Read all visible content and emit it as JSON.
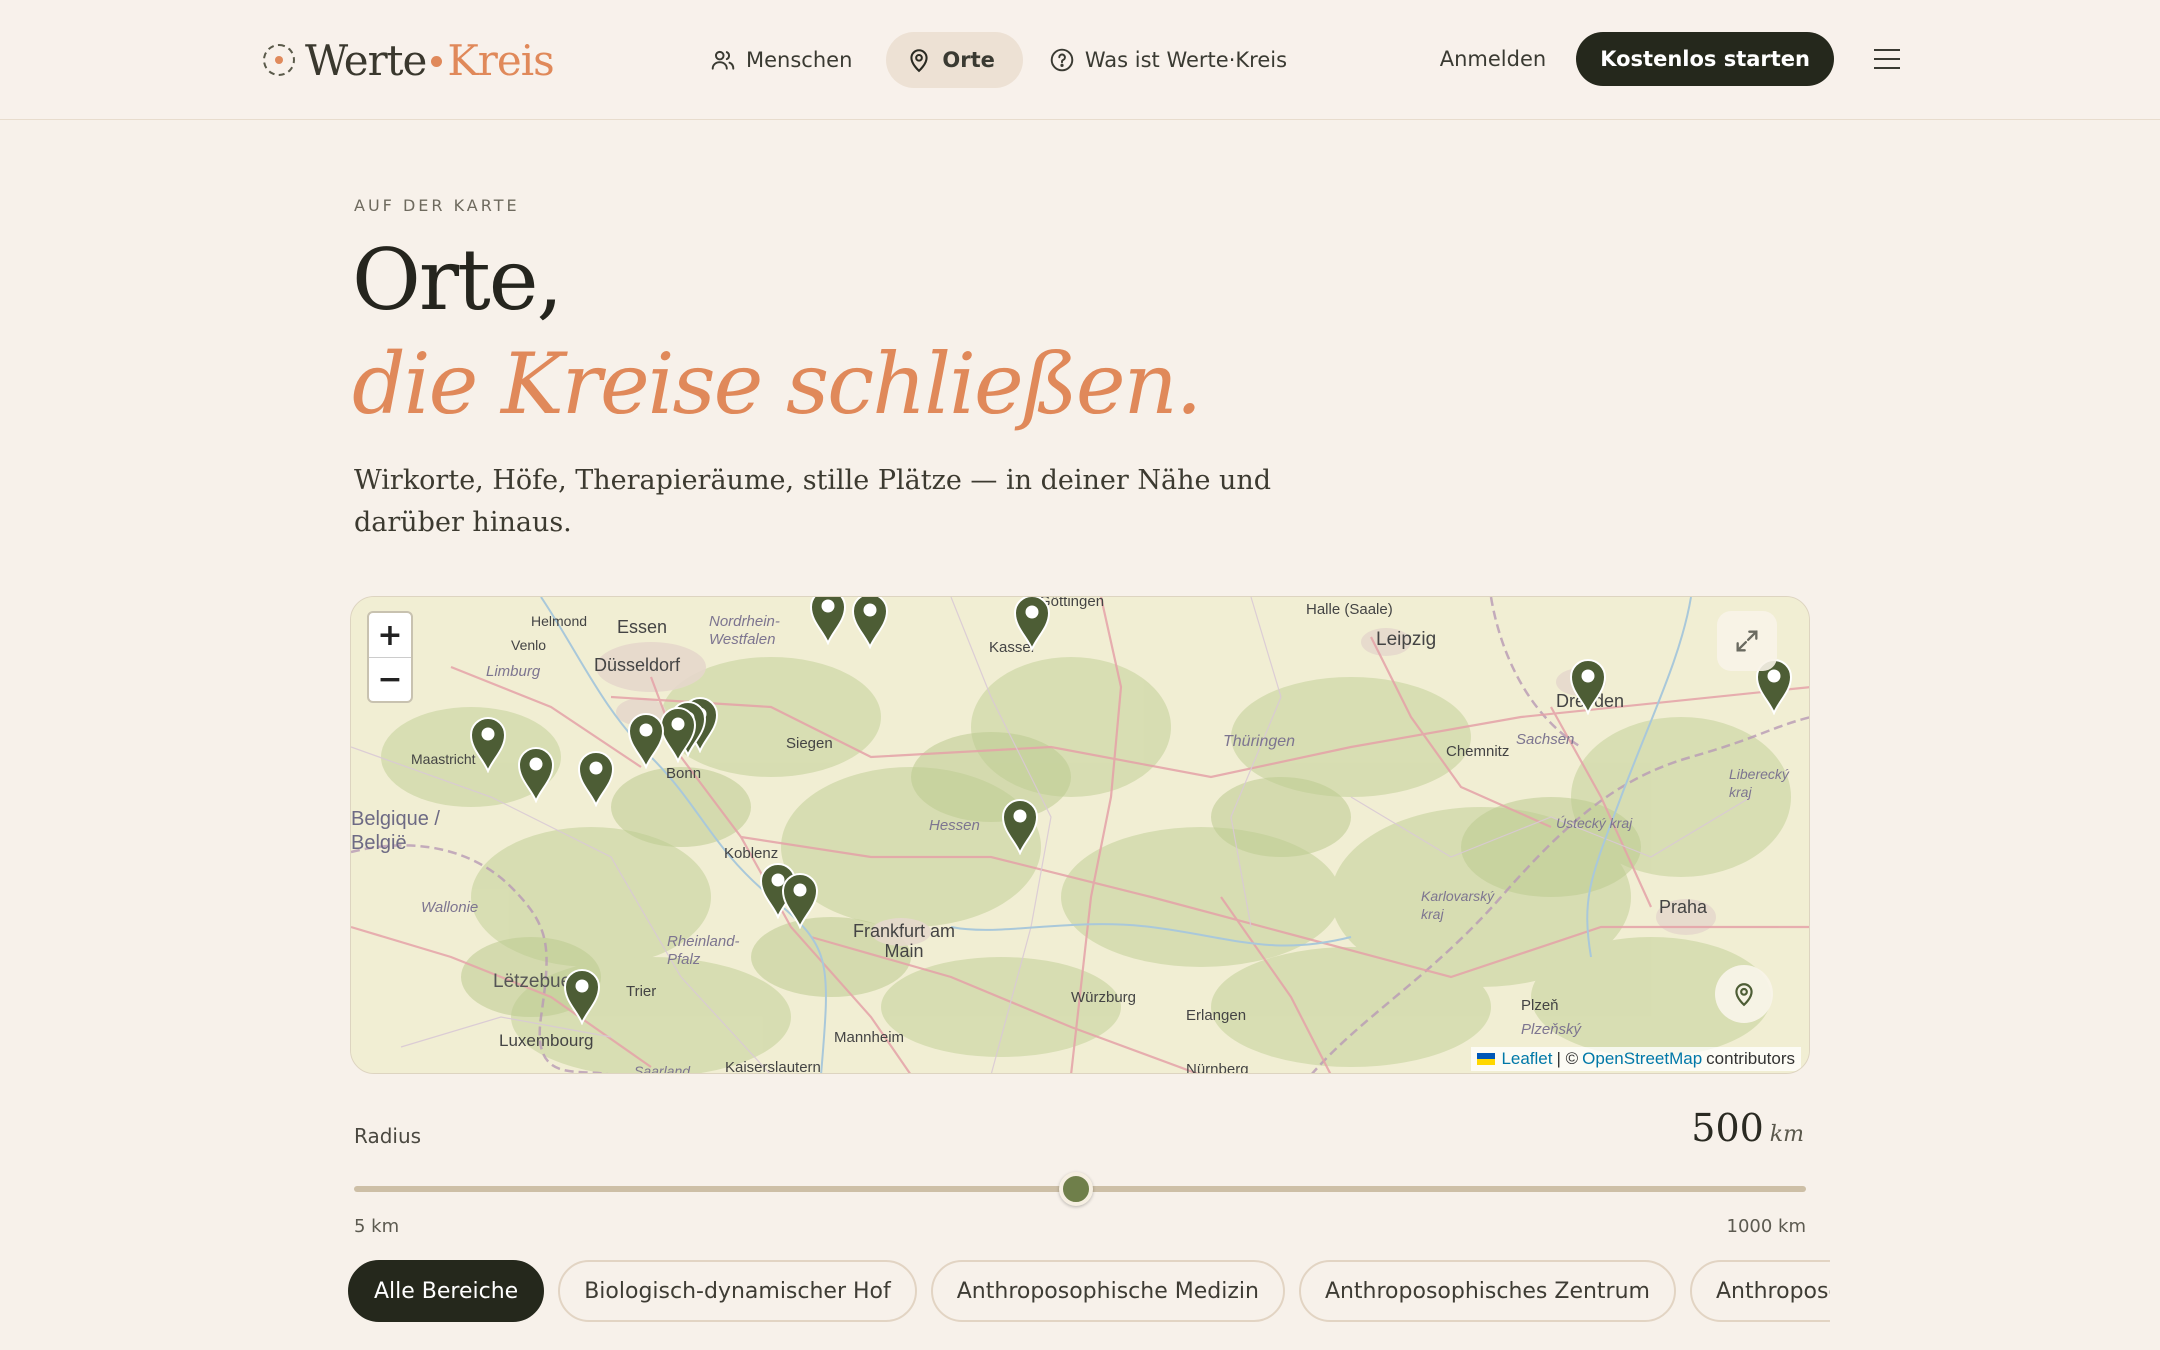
{
  "brand": {
    "name_part1": "Werte",
    "name_part2": "Kreis"
  },
  "nav": {
    "items": [
      {
        "label": "Menschen",
        "icon": "users-icon"
      },
      {
        "label": "Orte",
        "icon": "map-pin-icon",
        "active": true
      },
      {
        "label": "Was ist Werte·Kreis",
        "icon": "help-circle-icon"
      }
    ],
    "login_label": "Anmelden",
    "cta_label": "Kostenlos starten",
    "menu_icon": "hamburger-menu-icon"
  },
  "hero": {
    "eyebrow": "AUF DER KARTE",
    "title_line1": "Orte,",
    "title_line2": "die Kreise schließen.",
    "lead": "Wirkorte, Höfe, Therapieräume, stille Plätze — in deiner Nähe und darüber hinaus."
  },
  "map": {
    "zoom_in": "+",
    "zoom_out": "−",
    "attribution": {
      "leaflet": "Leaflet",
      "separator": "| ©",
      "osm": "OpenStreetMap",
      "contributors": "contributors"
    },
    "place_labels": [
      "Helmond",
      "Venlo",
      "Limburg",
      "Essen",
      "Düsseldorf",
      "Nordrhein-Westfalen",
      "Maastricht",
      "Siegen",
      "Bonn",
      "Kassel",
      "Göttingen",
      "Halle (Saale)",
      "Leipzig",
      "Dresden",
      "Sachsen",
      "Chemnitz",
      "Thüringen",
      "Hessen",
      "Koblenz",
      "Frankfurt am Main",
      "Rheinland-Pfalz",
      "Belgique / België",
      "Wallonie",
      "Lëtzebuerg",
      "Luxembourg",
      "Trier",
      "Mannheim",
      "Kaiserslautern",
      "Würzburg",
      "Erlangen",
      "Nürnberg",
      "Plzeň",
      "Plzeňský",
      "Praha",
      "Ústecký kraj",
      "Karlovarský kraj",
      "Liberecký kraj",
      "Saarland"
    ]
  },
  "radius": {
    "label": "Radius",
    "value": "500",
    "unit": "km",
    "min_label": "5 km",
    "max_label": "1000 km",
    "min": 5,
    "max": 1000,
    "current": 500
  },
  "filters": [
    "Alle Bereiche",
    "Biologisch-dynamischer Hof",
    "Anthroposophische Medizin",
    "Anthroposophisches Zentrum",
    "Anthroposophische"
  ],
  "colors": {
    "accent": "#e0895a",
    "dark": "#25281c",
    "pin": "#4d5d35",
    "background": "#f7f1ea"
  }
}
